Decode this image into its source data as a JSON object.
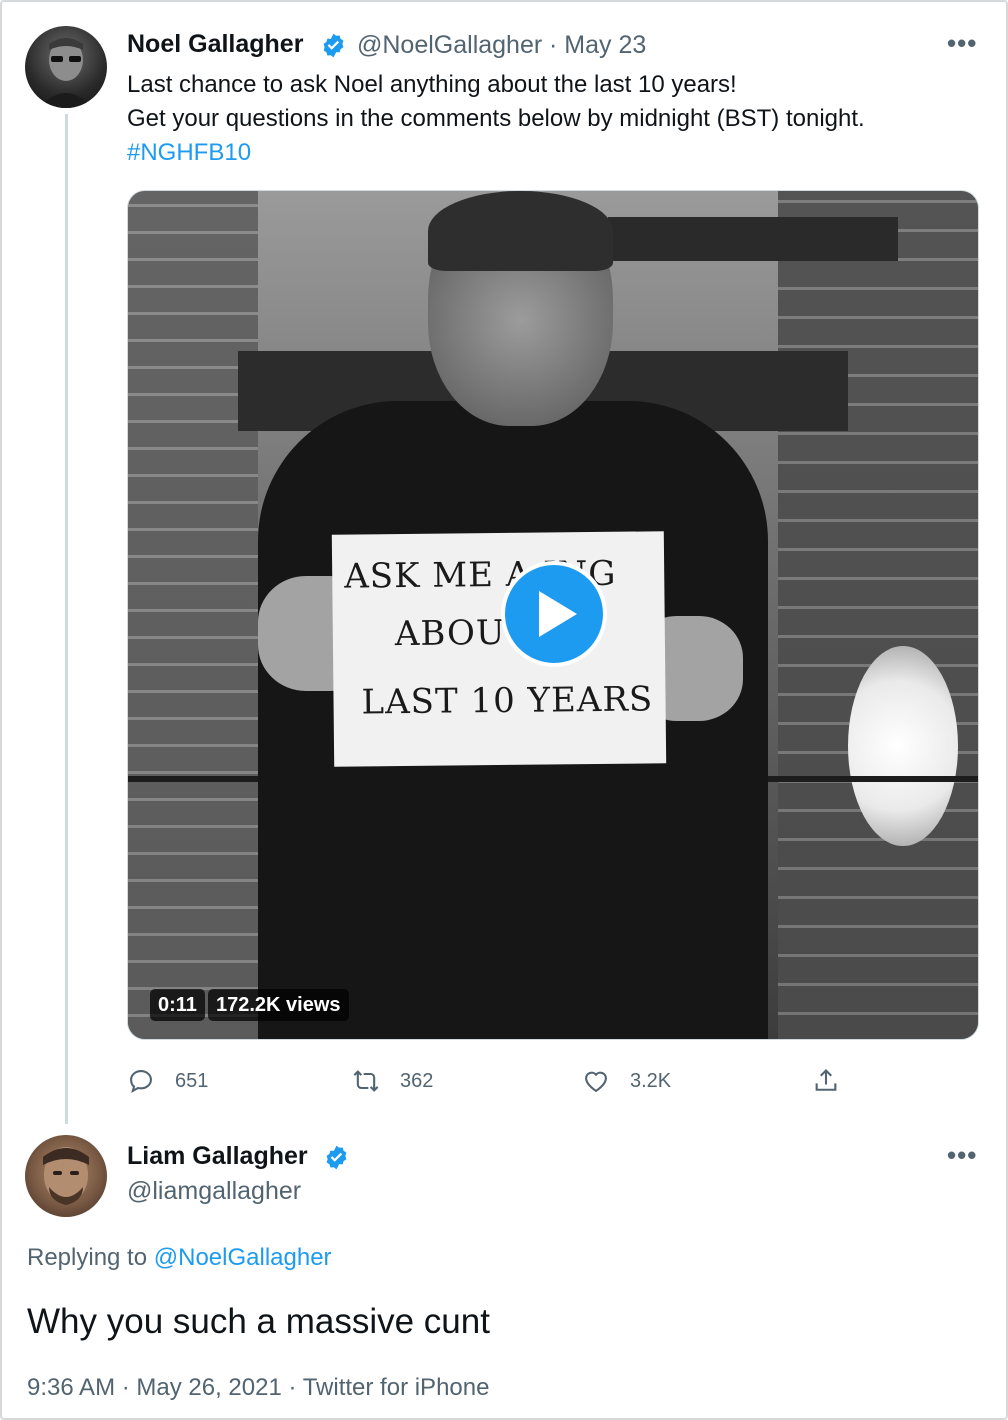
{
  "original_tweet": {
    "author_name": "Noel Gallagher",
    "handle": "@NoelGallagher",
    "date": "· May 23",
    "text_line_1": "Last chance to ask Noel anything about the last 10 years!",
    "text_line_2": "Get your questions in the comments below by midnight (BST) tonight.",
    "hashtag": "#NGHFB10",
    "more_label": "•••",
    "video": {
      "duration": "0:11",
      "views": "172.2K views",
      "sign_line_1": "ASK ME A  ING",
      "sign_line_2": "ABOU",
      "sign_line_3": "LAST 10 YEARS"
    },
    "actions": {
      "replies": "651",
      "retweets": "362",
      "likes": "3.2K"
    }
  },
  "reply_tweet": {
    "author_name": "Liam Gallagher",
    "handle": "@liamgallagher",
    "more_label": "•••",
    "replying_prefix": "Replying to ",
    "replying_to": "@NoelGallagher",
    "text": "Why you such a massive cunt",
    "meta": "9:36 AM · May 26, 2021 · Twitter for iPhone"
  },
  "colors": {
    "accent": "#1d9bf0",
    "secondary_text": "#536471",
    "primary_text": "#0f1419"
  },
  "icons": [
    "verified-badge-icon",
    "more-icon",
    "play-icon",
    "reply-icon",
    "retweet-icon",
    "like-icon",
    "share-icon"
  ]
}
